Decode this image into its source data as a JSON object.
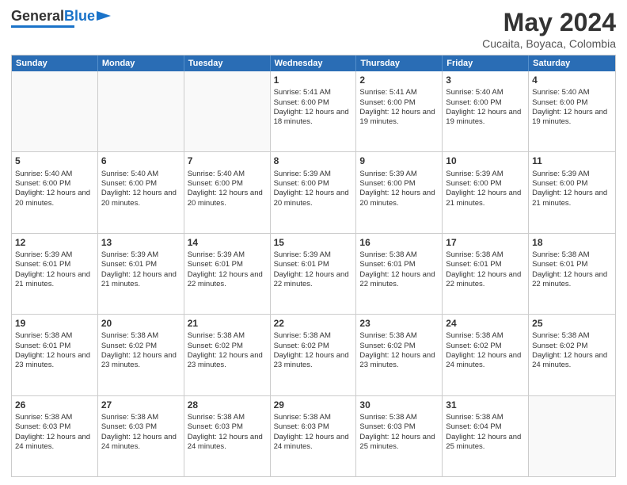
{
  "header": {
    "logo_general": "General",
    "logo_blue": "Blue",
    "month_title": "May 2024",
    "subtitle": "Cucaita, Boyaca, Colombia"
  },
  "weekdays": [
    "Sunday",
    "Monday",
    "Tuesday",
    "Wednesday",
    "Thursday",
    "Friday",
    "Saturday"
  ],
  "rows": [
    [
      {
        "day": "",
        "sunrise": "",
        "sunset": "",
        "daylight": "",
        "empty": true
      },
      {
        "day": "",
        "sunrise": "",
        "sunset": "",
        "daylight": "",
        "empty": true
      },
      {
        "day": "",
        "sunrise": "",
        "sunset": "",
        "daylight": "",
        "empty": true
      },
      {
        "day": "1",
        "sunrise": "Sunrise: 5:41 AM",
        "sunset": "Sunset: 6:00 PM",
        "daylight": "Daylight: 12 hours and 18 minutes.",
        "empty": false
      },
      {
        "day": "2",
        "sunrise": "Sunrise: 5:41 AM",
        "sunset": "Sunset: 6:00 PM",
        "daylight": "Daylight: 12 hours and 19 minutes.",
        "empty": false
      },
      {
        "day": "3",
        "sunrise": "Sunrise: 5:40 AM",
        "sunset": "Sunset: 6:00 PM",
        "daylight": "Daylight: 12 hours and 19 minutes.",
        "empty": false
      },
      {
        "day": "4",
        "sunrise": "Sunrise: 5:40 AM",
        "sunset": "Sunset: 6:00 PM",
        "daylight": "Daylight: 12 hours and 19 minutes.",
        "empty": false
      }
    ],
    [
      {
        "day": "5",
        "sunrise": "Sunrise: 5:40 AM",
        "sunset": "Sunset: 6:00 PM",
        "daylight": "Daylight: 12 hours and 20 minutes.",
        "empty": false
      },
      {
        "day": "6",
        "sunrise": "Sunrise: 5:40 AM",
        "sunset": "Sunset: 6:00 PM",
        "daylight": "Daylight: 12 hours and 20 minutes.",
        "empty": false
      },
      {
        "day": "7",
        "sunrise": "Sunrise: 5:40 AM",
        "sunset": "Sunset: 6:00 PM",
        "daylight": "Daylight: 12 hours and 20 minutes.",
        "empty": false
      },
      {
        "day": "8",
        "sunrise": "Sunrise: 5:39 AM",
        "sunset": "Sunset: 6:00 PM",
        "daylight": "Daylight: 12 hours and 20 minutes.",
        "empty": false
      },
      {
        "day": "9",
        "sunrise": "Sunrise: 5:39 AM",
        "sunset": "Sunset: 6:00 PM",
        "daylight": "Daylight: 12 hours and 20 minutes.",
        "empty": false
      },
      {
        "day": "10",
        "sunrise": "Sunrise: 5:39 AM",
        "sunset": "Sunset: 6:00 PM",
        "daylight": "Daylight: 12 hours and 21 minutes.",
        "empty": false
      },
      {
        "day": "11",
        "sunrise": "Sunrise: 5:39 AM",
        "sunset": "Sunset: 6:00 PM",
        "daylight": "Daylight: 12 hours and 21 minutes.",
        "empty": false
      }
    ],
    [
      {
        "day": "12",
        "sunrise": "Sunrise: 5:39 AM",
        "sunset": "Sunset: 6:01 PM",
        "daylight": "Daylight: 12 hours and 21 minutes.",
        "empty": false
      },
      {
        "day": "13",
        "sunrise": "Sunrise: 5:39 AM",
        "sunset": "Sunset: 6:01 PM",
        "daylight": "Daylight: 12 hours and 21 minutes.",
        "empty": false
      },
      {
        "day": "14",
        "sunrise": "Sunrise: 5:39 AM",
        "sunset": "Sunset: 6:01 PM",
        "daylight": "Daylight: 12 hours and 22 minutes.",
        "empty": false
      },
      {
        "day": "15",
        "sunrise": "Sunrise: 5:39 AM",
        "sunset": "Sunset: 6:01 PM",
        "daylight": "Daylight: 12 hours and 22 minutes.",
        "empty": false
      },
      {
        "day": "16",
        "sunrise": "Sunrise: 5:38 AM",
        "sunset": "Sunset: 6:01 PM",
        "daylight": "Daylight: 12 hours and 22 minutes.",
        "empty": false
      },
      {
        "day": "17",
        "sunrise": "Sunrise: 5:38 AM",
        "sunset": "Sunset: 6:01 PM",
        "daylight": "Daylight: 12 hours and 22 minutes.",
        "empty": false
      },
      {
        "day": "18",
        "sunrise": "Sunrise: 5:38 AM",
        "sunset": "Sunset: 6:01 PM",
        "daylight": "Daylight: 12 hours and 22 minutes.",
        "empty": false
      }
    ],
    [
      {
        "day": "19",
        "sunrise": "Sunrise: 5:38 AM",
        "sunset": "Sunset: 6:01 PM",
        "daylight": "Daylight: 12 hours and 23 minutes.",
        "empty": false
      },
      {
        "day": "20",
        "sunrise": "Sunrise: 5:38 AM",
        "sunset": "Sunset: 6:02 PM",
        "daylight": "Daylight: 12 hours and 23 minutes.",
        "empty": false
      },
      {
        "day": "21",
        "sunrise": "Sunrise: 5:38 AM",
        "sunset": "Sunset: 6:02 PM",
        "daylight": "Daylight: 12 hours and 23 minutes.",
        "empty": false
      },
      {
        "day": "22",
        "sunrise": "Sunrise: 5:38 AM",
        "sunset": "Sunset: 6:02 PM",
        "daylight": "Daylight: 12 hours and 23 minutes.",
        "empty": false
      },
      {
        "day": "23",
        "sunrise": "Sunrise: 5:38 AM",
        "sunset": "Sunset: 6:02 PM",
        "daylight": "Daylight: 12 hours and 23 minutes.",
        "empty": false
      },
      {
        "day": "24",
        "sunrise": "Sunrise: 5:38 AM",
        "sunset": "Sunset: 6:02 PM",
        "daylight": "Daylight: 12 hours and 24 minutes.",
        "empty": false
      },
      {
        "day": "25",
        "sunrise": "Sunrise: 5:38 AM",
        "sunset": "Sunset: 6:02 PM",
        "daylight": "Daylight: 12 hours and 24 minutes.",
        "empty": false
      }
    ],
    [
      {
        "day": "26",
        "sunrise": "Sunrise: 5:38 AM",
        "sunset": "Sunset: 6:03 PM",
        "daylight": "Daylight: 12 hours and 24 minutes.",
        "empty": false
      },
      {
        "day": "27",
        "sunrise": "Sunrise: 5:38 AM",
        "sunset": "Sunset: 6:03 PM",
        "daylight": "Daylight: 12 hours and 24 minutes.",
        "empty": false
      },
      {
        "day": "28",
        "sunrise": "Sunrise: 5:38 AM",
        "sunset": "Sunset: 6:03 PM",
        "daylight": "Daylight: 12 hours and 24 minutes.",
        "empty": false
      },
      {
        "day": "29",
        "sunrise": "Sunrise: 5:38 AM",
        "sunset": "Sunset: 6:03 PM",
        "daylight": "Daylight: 12 hours and 24 minutes.",
        "empty": false
      },
      {
        "day": "30",
        "sunrise": "Sunrise: 5:38 AM",
        "sunset": "Sunset: 6:03 PM",
        "daylight": "Daylight: 12 hours and 25 minutes.",
        "empty": false
      },
      {
        "day": "31",
        "sunrise": "Sunrise: 5:38 AM",
        "sunset": "Sunset: 6:04 PM",
        "daylight": "Daylight: 12 hours and 25 minutes.",
        "empty": false
      },
      {
        "day": "",
        "sunrise": "",
        "sunset": "",
        "daylight": "",
        "empty": true
      }
    ]
  ]
}
